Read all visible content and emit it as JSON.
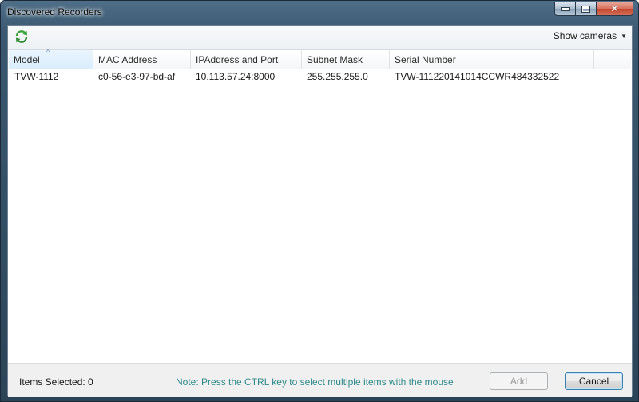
{
  "window": {
    "title": "Discovered Recorders",
    "controls": [
      "minimize-icon",
      "maximize-icon",
      "close-icon"
    ]
  },
  "toolbar": {
    "refresh_icon": "refresh-icon",
    "show_cameras_label": "Show cameras"
  },
  "table": {
    "columns": [
      "Model",
      "MAC Address",
      "IPAddress and Port",
      "Subnet Mask",
      "Serial Number"
    ],
    "sorted_column": "Model",
    "rows": [
      [
        "TVW-1112",
        "c0-56-e3-97-bd-af",
        "10.113.57.24:8000",
        "255.255.255.0",
        "TVW-111220141014CCWR484332522"
      ]
    ]
  },
  "footer": {
    "items_selected": "Items Selected: 0",
    "note": "Note: Press the CTRL key to select multiple items with the mouse",
    "add_label": "Add",
    "cancel_label": "Cancel"
  },
  "colors": {
    "note_text": "#2e8a8a",
    "sorted_header": "#d9edfb",
    "close_button": "#c5432a"
  }
}
